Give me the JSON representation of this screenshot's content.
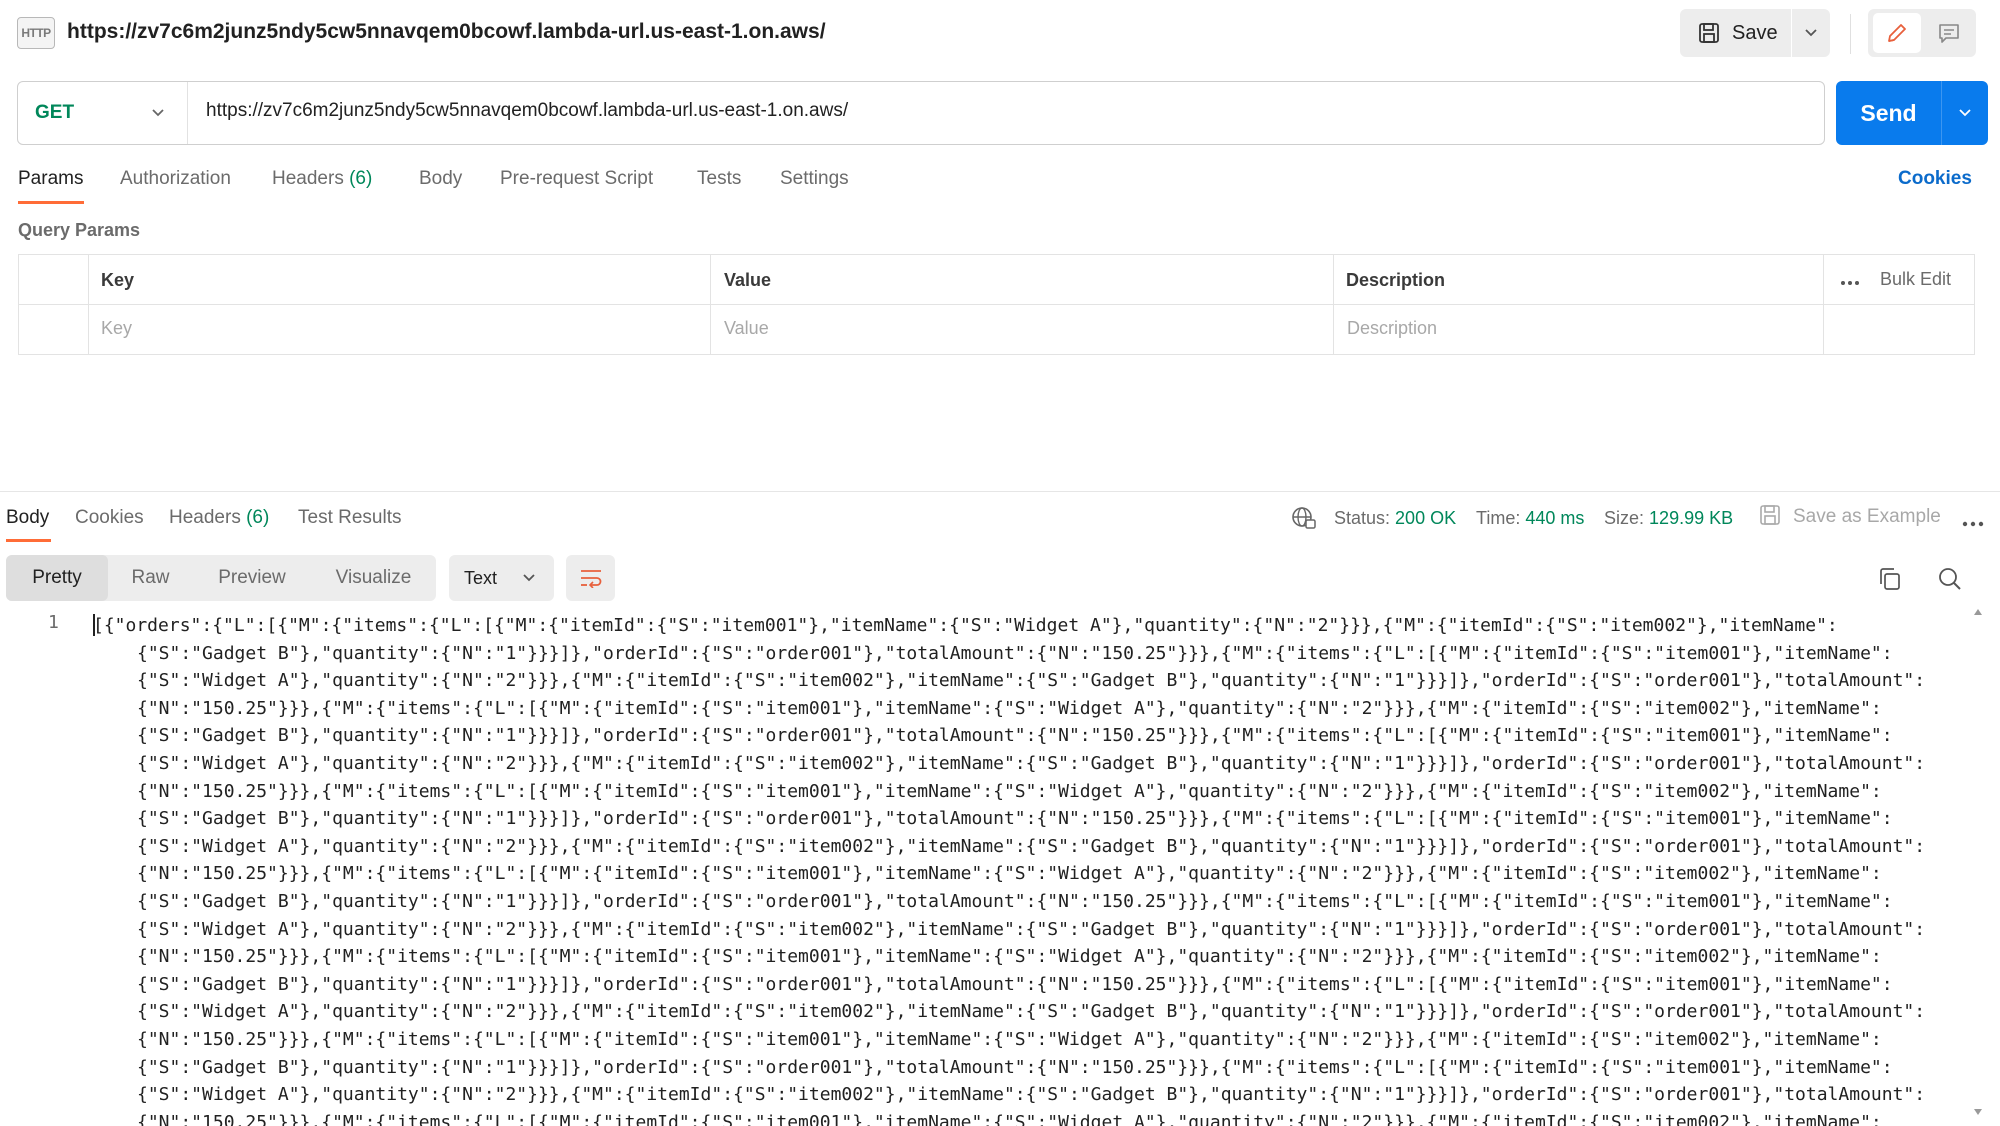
{
  "header": {
    "icon_label": "HTTP",
    "title": "https://zv7c6m2junz5ndy5cw5nnavqem0bcowf.lambda-url.us-east-1.on.aws/",
    "save_label": "Save"
  },
  "request": {
    "method": "GET",
    "url": "https://zv7c6m2junz5ndy5cw5nnavqem0bcowf.lambda-url.us-east-1.on.aws/",
    "send_label": "Send"
  },
  "request_tabs": {
    "params": "Params",
    "authorization": "Authorization",
    "headers": "Headers",
    "headers_count": "(6)",
    "body": "Body",
    "pre_request": "Pre-request Script",
    "tests": "Tests",
    "settings": "Settings",
    "cookies": "Cookies"
  },
  "query_params": {
    "title": "Query Params",
    "columns": {
      "key": "Key",
      "value": "Value",
      "description": "Description"
    },
    "bulk_edit": "Bulk Edit",
    "placeholders": {
      "key": "Key",
      "value": "Value",
      "description": "Description"
    }
  },
  "response_tabs": {
    "body": "Body",
    "cookies": "Cookies",
    "headers": "Headers",
    "headers_count": "(6)",
    "test_results": "Test Results"
  },
  "response_meta": {
    "status_label": "Status:",
    "status_value": "200 OK",
    "time_label": "Time:",
    "time_value": "440 ms",
    "size_label": "Size:",
    "size_value": "129.99 KB",
    "save_example": "Save as Example"
  },
  "response_toolbar": {
    "pretty": "Pretty",
    "raw": "Raw",
    "preview": "Preview",
    "visualize": "Visualize",
    "format": "Text"
  },
  "response_body": {
    "line_number": "1",
    "lines": [
      "[{\"orders\":{\"L\":[{\"M\":{\"items\":{\"L\":[{\"M\":{\"itemId\":{\"S\":\"item001\"},\"itemName\":{\"S\":\"Widget A\"},\"quantity\":{\"N\":\"2\"}}},{\"M\":{\"itemId\":{\"S\":\"item002\"},\"itemName\":",
      "{\"S\":\"Gadget B\"},\"quantity\":{\"N\":\"1\"}}}]},\"orderId\":{\"S\":\"order001\"},\"totalAmount\":{\"N\":\"150.25\"}}},{\"M\":{\"items\":{\"L\":[{\"M\":{\"itemId\":{\"S\":\"item001\"},\"itemName\":",
      "{\"S\":\"Widget A\"},\"quantity\":{\"N\":\"2\"}}},{\"M\":{\"itemId\":{\"S\":\"item002\"},\"itemName\":{\"S\":\"Gadget B\"},\"quantity\":{\"N\":\"1\"}}}]},\"orderId\":{\"S\":\"order001\"},\"totalAmount\":",
      "{\"N\":\"150.25\"}}},{\"M\":{\"items\":{\"L\":[{\"M\":{\"itemId\":{\"S\":\"item001\"},\"itemName\":{\"S\":\"Widget A\"},\"quantity\":{\"N\":\"2\"}}},{\"M\":{\"itemId\":{\"S\":\"item002\"},\"itemName\":",
      "{\"S\":\"Gadget B\"},\"quantity\":{\"N\":\"1\"}}}]},\"orderId\":{\"S\":\"order001\"},\"totalAmount\":{\"N\":\"150.25\"}}},{\"M\":{\"items\":{\"L\":[{\"M\":{\"itemId\":{\"S\":\"item001\"},\"itemName\":",
      "{\"S\":\"Widget A\"},\"quantity\":{\"N\":\"2\"}}},{\"M\":{\"itemId\":{\"S\":\"item002\"},\"itemName\":{\"S\":\"Gadget B\"},\"quantity\":{\"N\":\"1\"}}}]},\"orderId\":{\"S\":\"order001\"},\"totalAmount\":",
      "{\"N\":\"150.25\"}}},{\"M\":{\"items\":{\"L\":[{\"M\":{\"itemId\":{\"S\":\"item001\"},\"itemName\":{\"S\":\"Widget A\"},\"quantity\":{\"N\":\"2\"}}},{\"M\":{\"itemId\":{\"S\":\"item002\"},\"itemName\":",
      "{\"S\":\"Gadget B\"},\"quantity\":{\"N\":\"1\"}}}]},\"orderId\":{\"S\":\"order001\"},\"totalAmount\":{\"N\":\"150.25\"}}},{\"M\":{\"items\":{\"L\":[{\"M\":{\"itemId\":{\"S\":\"item001\"},\"itemName\":",
      "{\"S\":\"Widget A\"},\"quantity\":{\"N\":\"2\"}}},{\"M\":{\"itemId\":{\"S\":\"item002\"},\"itemName\":{\"S\":\"Gadget B\"},\"quantity\":{\"N\":\"1\"}}}]},\"orderId\":{\"S\":\"order001\"},\"totalAmount\":",
      "{\"N\":\"150.25\"}}},{\"M\":{\"items\":{\"L\":[{\"M\":{\"itemId\":{\"S\":\"item001\"},\"itemName\":{\"S\":\"Widget A\"},\"quantity\":{\"N\":\"2\"}}},{\"M\":{\"itemId\":{\"S\":\"item002\"},\"itemName\":",
      "{\"S\":\"Gadget B\"},\"quantity\":{\"N\":\"1\"}}}]},\"orderId\":{\"S\":\"order001\"},\"totalAmount\":{\"N\":\"150.25\"}}},{\"M\":{\"items\":{\"L\":[{\"M\":{\"itemId\":{\"S\":\"item001\"},\"itemName\":",
      "{\"S\":\"Widget A\"},\"quantity\":{\"N\":\"2\"}}},{\"M\":{\"itemId\":{\"S\":\"item002\"},\"itemName\":{\"S\":\"Gadget B\"},\"quantity\":{\"N\":\"1\"}}}]},\"orderId\":{\"S\":\"order001\"},\"totalAmount\":",
      "{\"N\":\"150.25\"}}},{\"M\":{\"items\":{\"L\":[{\"M\":{\"itemId\":{\"S\":\"item001\"},\"itemName\":{\"S\":\"Widget A\"},\"quantity\":{\"N\":\"2\"}}},{\"M\":{\"itemId\":{\"S\":\"item002\"},\"itemName\":",
      "{\"S\":\"Gadget B\"},\"quantity\":{\"N\":\"1\"}}}]},\"orderId\":{\"S\":\"order001\"},\"totalAmount\":{\"N\":\"150.25\"}}},{\"M\":{\"items\":{\"L\":[{\"M\":{\"itemId\":{\"S\":\"item001\"},\"itemName\":",
      "{\"S\":\"Widget A\"},\"quantity\":{\"N\":\"2\"}}},{\"M\":{\"itemId\":{\"S\":\"item002\"},\"itemName\":{\"S\":\"Gadget B\"},\"quantity\":{\"N\":\"1\"}}}]},\"orderId\":{\"S\":\"order001\"},\"totalAmount\":",
      "{\"N\":\"150.25\"}}},{\"M\":{\"items\":{\"L\":[{\"M\":{\"itemId\":{\"S\":\"item001\"},\"itemName\":{\"S\":\"Widget A\"},\"quantity\":{\"N\":\"2\"}}},{\"M\":{\"itemId\":{\"S\":\"item002\"},\"itemName\":",
      "{\"S\":\"Gadget B\"},\"quantity\":{\"N\":\"1\"}}}]},\"orderId\":{\"S\":\"order001\"},\"totalAmount\":{\"N\":\"150.25\"}}},{\"M\":{\"items\":{\"L\":[{\"M\":{\"itemId\":{\"S\":\"item001\"},\"itemName\":",
      "{\"S\":\"Widget A\"},\"quantity\":{\"N\":\"2\"}}},{\"M\":{\"itemId\":{\"S\":\"item002\"},\"itemName\":{\"S\":\"Gadget B\"},\"quantity\":{\"N\":\"1\"}}}]},\"orderId\":{\"S\":\"order001\"},\"totalAmount\":",
      "{\"N\":\"150.25\"}}},{\"M\":{\"items\":{\"L\":[{\"M\":{\"itemId\":{\"S\":\"item001\"},\"itemName\":{\"S\":\"Widget A\"},\"quantity\":{\"N\":\"2\"}}},{\"M\":{\"itemId\":{\"S\":\"item002\"},\"itemName\":"
    ]
  },
  "colors": {
    "accent_orange": "#ff6c37",
    "send_blue": "#097bed",
    "status_green": "#00875a",
    "link_blue": "#0b6bcb"
  },
  "icons": {
    "http": "http-icon",
    "save": "floppy-disk-icon",
    "edit": "pencil-icon",
    "comment": "comment-icon",
    "network": "globe-icon",
    "copy": "copy-icon",
    "search": "search-icon",
    "wrap": "wrap-lines-icon",
    "more": "more-horizontal-icon"
  }
}
